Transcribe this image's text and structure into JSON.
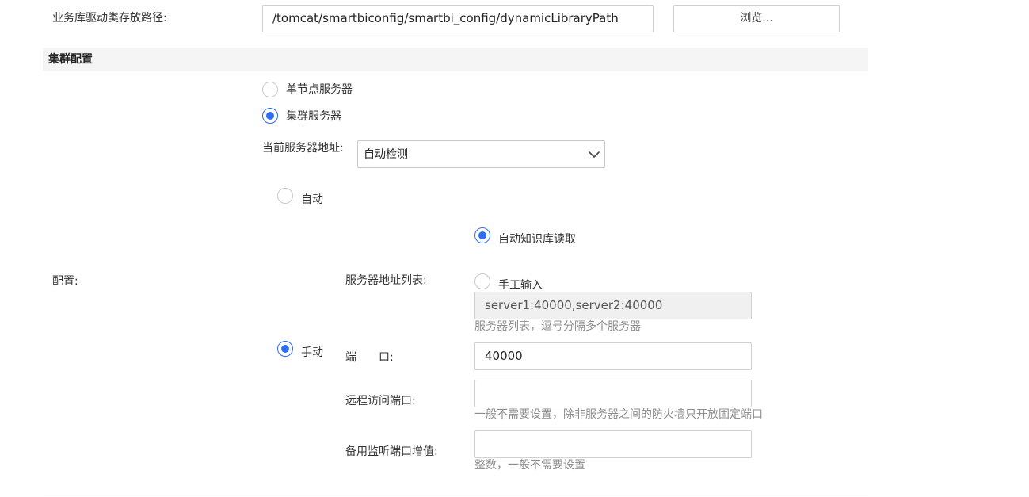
{
  "driver_path": {
    "label": "业务库驱动类存放路径:",
    "value": "/tomcat/smartbiconfig/smartbi_config/dynamicLibraryPath",
    "browse_label": "浏览..."
  },
  "cluster": {
    "section_title": "集群配置",
    "single_node_label": "单节点服务器",
    "cluster_label": "集群服务器",
    "current_server_label": "当前服务器地址:",
    "current_server_value": "自动检测",
    "config_label": "配置:",
    "auto_label": "自动",
    "manual_label": "手动",
    "server_list_label": "服务器地址列表:",
    "auto_read_label": "自动知识库读取",
    "manual_input_label": "手工输入",
    "server_list_value": "server1:40000,server2:40000",
    "server_list_hint": "服务器列表，逗号分隔多个服务器",
    "port_label": "端　　口:",
    "port_value": "40000",
    "remote_port_label": "远程访问端口:",
    "remote_port_value": "",
    "remote_port_hint": "一般不需要设置，除非服务器之间的防火墙只开放固定端口",
    "backup_port_label": "备用监听端口增值:",
    "backup_port_value": "",
    "backup_port_hint": "整数，一般不需要设置"
  },
  "colors": {
    "accent": "#2d6ff0",
    "header_bg": "#f5f5f5",
    "hint": "#8c8c8c"
  }
}
